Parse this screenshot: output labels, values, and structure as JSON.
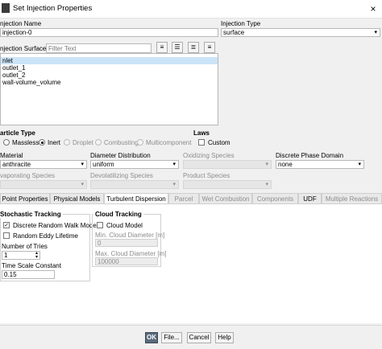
{
  "window": {
    "title": "Set Injection Properties",
    "close_label": "×"
  },
  "injection_name": {
    "label": "njection Name",
    "value": "injection-0"
  },
  "injection_type": {
    "label": "Injection Type",
    "value": "surface"
  },
  "surfaces": {
    "label": "njection Surfaces",
    "filter_placeholder": "Filter Text",
    "items": [
      "nlet",
      "outlet_1",
      "outlet_2",
      "wall-volume_volume"
    ],
    "selected_index": 0
  },
  "particle_type": {
    "label": "article Type",
    "options": [
      "Massless",
      "Inert",
      "Droplet",
      "Combusting",
      "Multicomponent"
    ],
    "selected": "Inert"
  },
  "laws": {
    "label": "Laws",
    "custom_label": "Custom"
  },
  "material": {
    "label": "Material",
    "value": "anthracite"
  },
  "diameter_distribution": {
    "label": "Diameter Distribution",
    "value": "uniform"
  },
  "oxidizing_species": {
    "label": "Oxidizing Species",
    "value": ""
  },
  "discrete_phase_domain": {
    "label": "Discrete Phase Domain",
    "value": "none"
  },
  "evaporating_species": {
    "label": "vaporating Species",
    "value": ""
  },
  "devolatilizing_species": {
    "label": "Devolatilizing Species",
    "value": ""
  },
  "product_species": {
    "label": "Product Species",
    "value": ""
  },
  "tabs": [
    {
      "label": "Point Properties",
      "state": "normal"
    },
    {
      "label": "Physical Models",
      "state": "normal"
    },
    {
      "label": "Turbulent Dispersion",
      "state": "active"
    },
    {
      "label": "Parcel",
      "state": "disabled"
    },
    {
      "label": "Wet Combustion",
      "state": "disabled"
    },
    {
      "label": "Components",
      "state": "disabled"
    },
    {
      "label": "UDF",
      "state": "normal"
    },
    {
      "label": "Multiple Reactions",
      "state": "disabled"
    }
  ],
  "stochastic": {
    "title": "Stochastic Tracking",
    "discrete_random_walk": {
      "label": "Discrete Random Walk Model",
      "checked": true
    },
    "random_eddy": {
      "label": "Random Eddy Lifetime",
      "checked": false
    },
    "tries": {
      "label": "Number of Tries",
      "value": "1"
    },
    "time_scale": {
      "label": "Time Scale Constant",
      "value": "0.15"
    }
  },
  "cloud": {
    "title": "Cloud Tracking",
    "cloud_model": {
      "label": "Cloud Model",
      "checked": false
    },
    "min_diameter": {
      "label": "Min. Cloud Diameter [m]",
      "value": "0"
    },
    "max_diameter": {
      "label": "Max. Cloud Diameter [m]",
      "value": "100000"
    }
  },
  "buttons": {
    "ok": "OK",
    "file": "File...",
    "cancel": "Cancel",
    "help": "Help"
  },
  "icons": {
    "check": "✓",
    "arrow": "▾"
  }
}
